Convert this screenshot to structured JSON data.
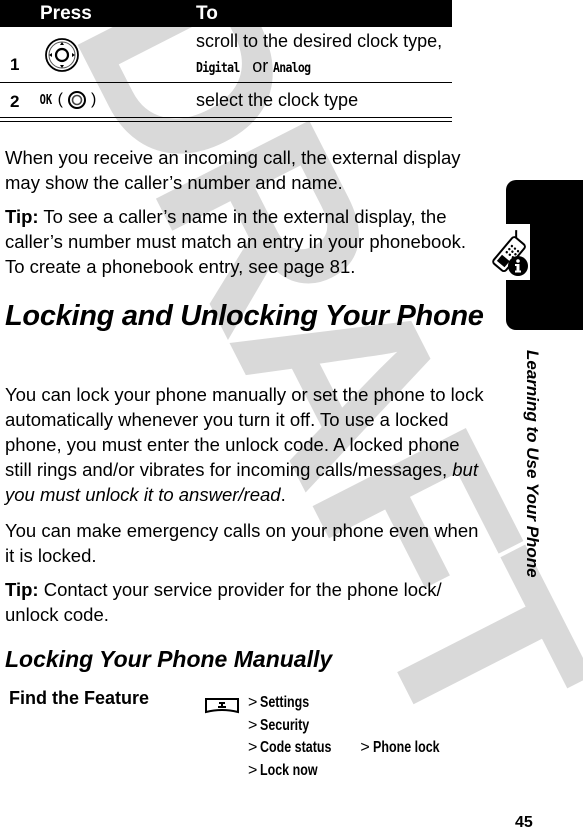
{
  "table": {
    "headers": [
      "Press",
      "To"
    ],
    "rows": [
      {
        "number": "1",
        "press_icon": "navigation-key-icon",
        "to_text_prefix": "scroll to the desired clock type, ",
        "to_option_1": "Digital",
        "to_text_or": " or ",
        "to_option_2": "Analog"
      },
      {
        "number": "2",
        "press_label": "OK",
        "press_open": "(",
        "press_icon": "center-select-key-icon",
        "press_close": ")",
        "to_text": "select the clock type"
      }
    ]
  },
  "paragraph_1": "When you receive an incoming call, the external display may show the caller’s number and name.",
  "tip_1": {
    "label": "Tip:",
    "text": " To see a caller’s name in the external display, the caller’s number must match an entry in your phonebook. To create a phonebook entry, see page 81."
  },
  "heading_1": "Locking and Unlocking Your Phone",
  "paragraph_2": {
    "text": "You can lock your phone manually or set the phone to lock automatically whenever you turn it off. To use a locked phone, you must enter the unlock code. A locked phone still rings and/or vibrates for incoming calls/messages, ",
    "emphasis": "but you must unlock it to answer/read",
    "end": "."
  },
  "paragraph_3": "You can make emergency calls on your phone even when it is locked.",
  "tip_2": {
    "label": "Tip:",
    "text": " Contact your service provider for the phone lock/ unlock code."
  },
  "heading_2": "Locking Your Phone Manually",
  "find_the_feature": {
    "label": "Find the Feature",
    "start_icon": "menu-key-icon",
    "separator": ">",
    "steps": [
      [
        "Settings"
      ],
      [
        "Security"
      ],
      [
        "Code status",
        "Phone lock"
      ],
      [
        "Lock now"
      ]
    ]
  },
  "side_tab": {
    "icon": "phone-info-icon",
    "label": "Learning to Use Your Phone"
  },
  "watermark": "DRAFT",
  "page_number": "45"
}
